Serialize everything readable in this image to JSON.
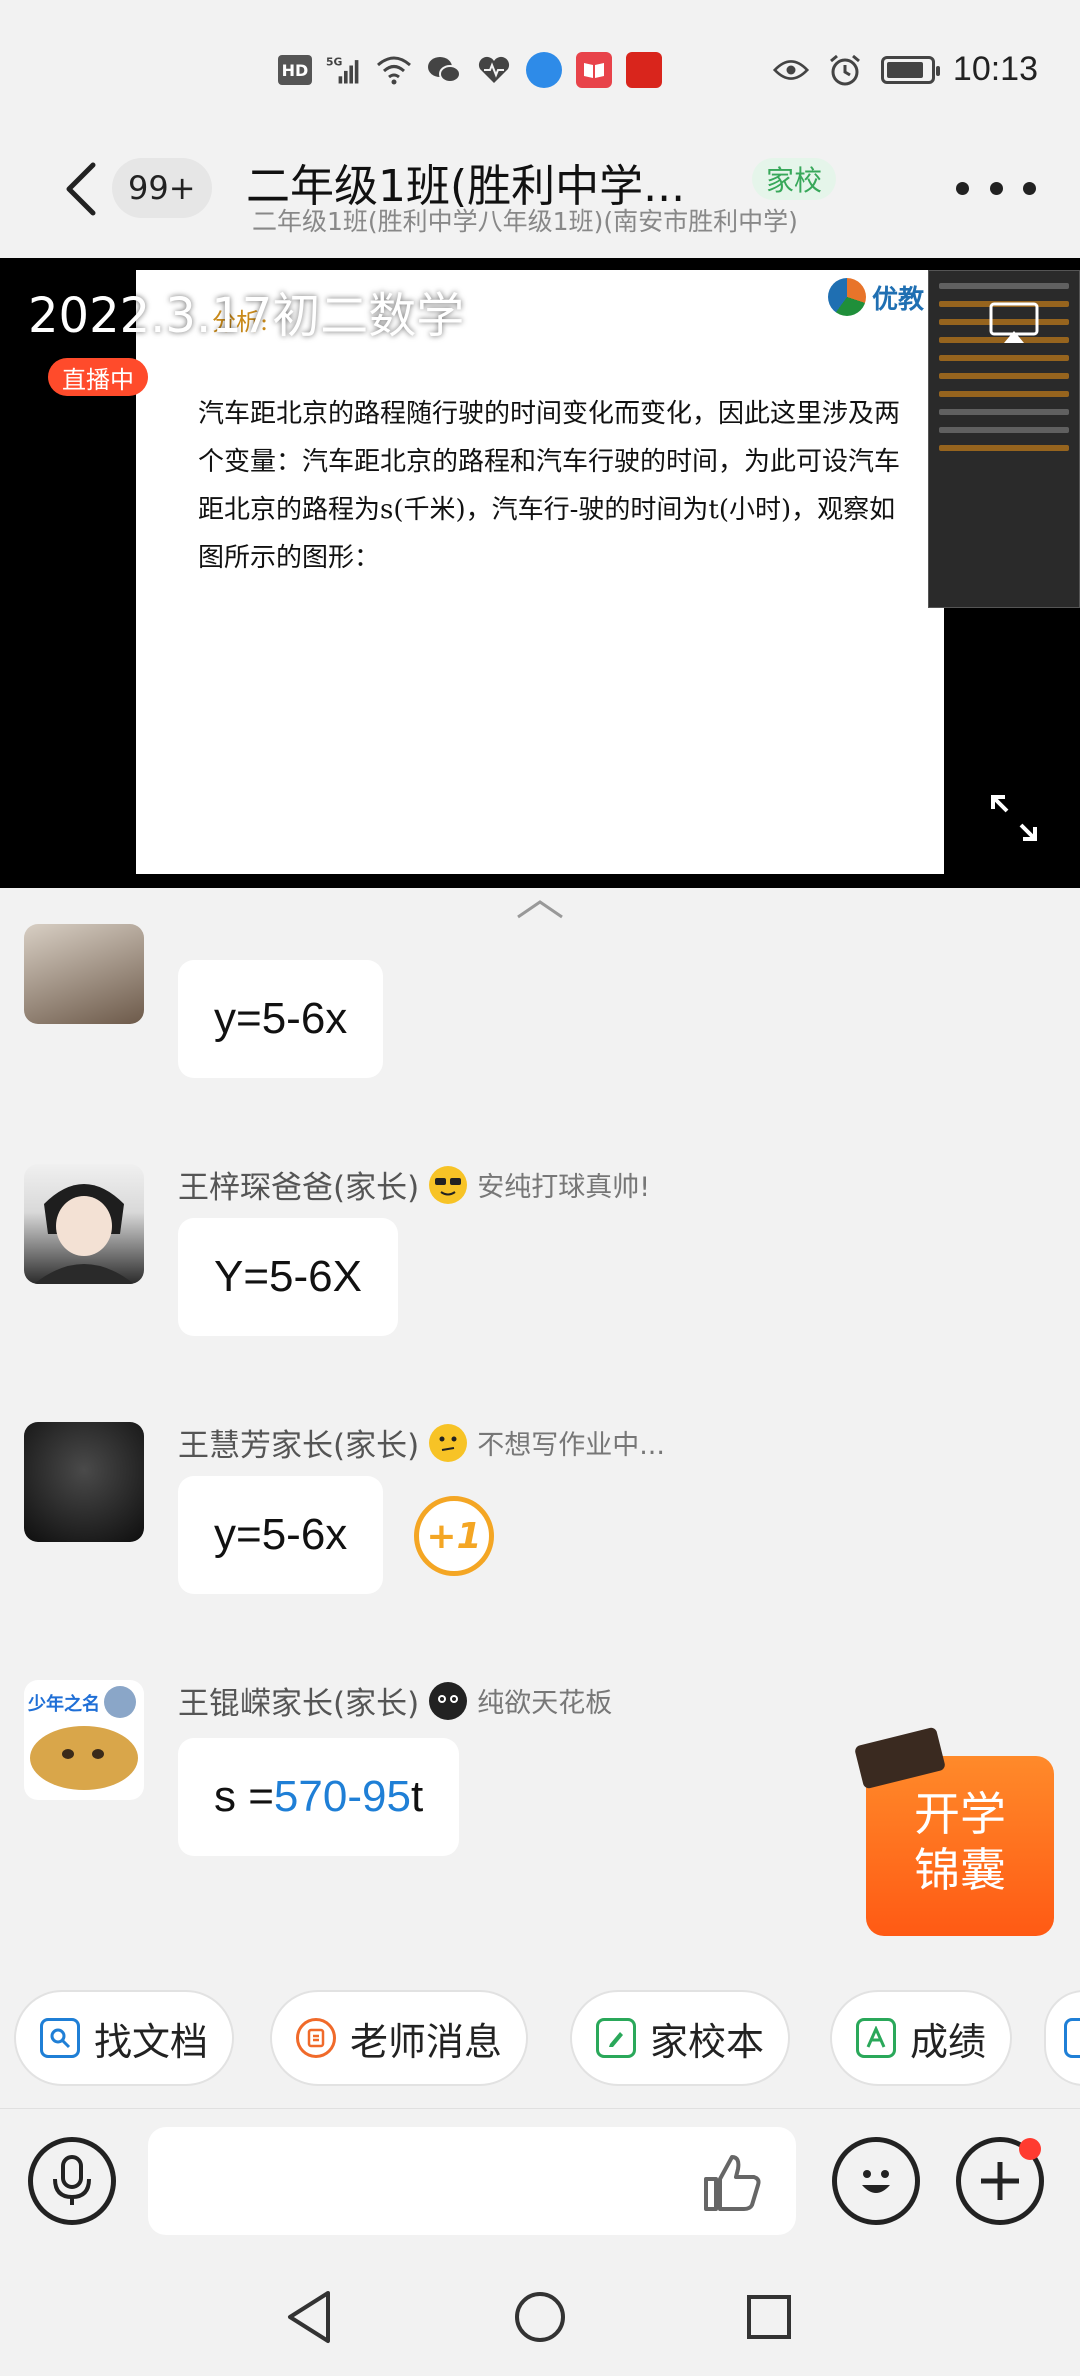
{
  "status_bar": {
    "hd_label": "HD",
    "network_label": "5G",
    "time": "10:13",
    "battery_level": 0.85
  },
  "header": {
    "unread_count": "99+",
    "title": "二年级1班(胜利中学...",
    "tag": "家校",
    "subtitle": "二年级1班(胜利中学八年级1班)(南安市胜利中学)"
  },
  "live": {
    "title": "2022.3.17初二数学",
    "badge": "直播中",
    "slide_label": "分析:",
    "slide_logo": "优教",
    "slide_text": "汽车距北京的路程随行驶的时间变化而变化，因此这里涉及两个变量：汽车距北京的路程和汽车行驶的时间，为此可设汽车距北京的路程为s(千米)，汽车行-驶的时间为t(小时)，观察如图所示的图形："
  },
  "chat": {
    "messages": [
      {
        "sender": "",
        "signature": "",
        "text": "y=5-6x"
      },
      {
        "sender": "王梓琛爸爸(家长)",
        "signature": "安纯打球真帅!",
        "text": "Y=5-6X"
      },
      {
        "sender": "王慧芳家长(家长)",
        "signature": "不想写作业中...",
        "text": "y=5-6x"
      },
      {
        "sender": "王锟嵘家长(家长)",
        "signature": "纯欲天花板",
        "text_prefix": "s = ",
        "text_highlight": "570-95",
        "text_suffix": "t"
      }
    ],
    "plus_one": "+1",
    "avatar4_caption": "少年之名"
  },
  "promo": {
    "line1": "开学",
    "line2": "锦囊"
  },
  "quick_actions": [
    {
      "label": "找文档",
      "color": "#1f7fd6"
    },
    {
      "label": "老师消息",
      "color": "#f06a2a"
    },
    {
      "label": "家校本",
      "color": "#2aa85a"
    },
    {
      "label": "成绩",
      "color": "#2aa85a"
    }
  ],
  "input": {
    "placeholder": ""
  },
  "colors": {
    "accent_orange": "#ff5a14",
    "badge_red": "#ff4b2b",
    "link_blue": "#1f7fd6",
    "tag_green": "#38a85a"
  }
}
